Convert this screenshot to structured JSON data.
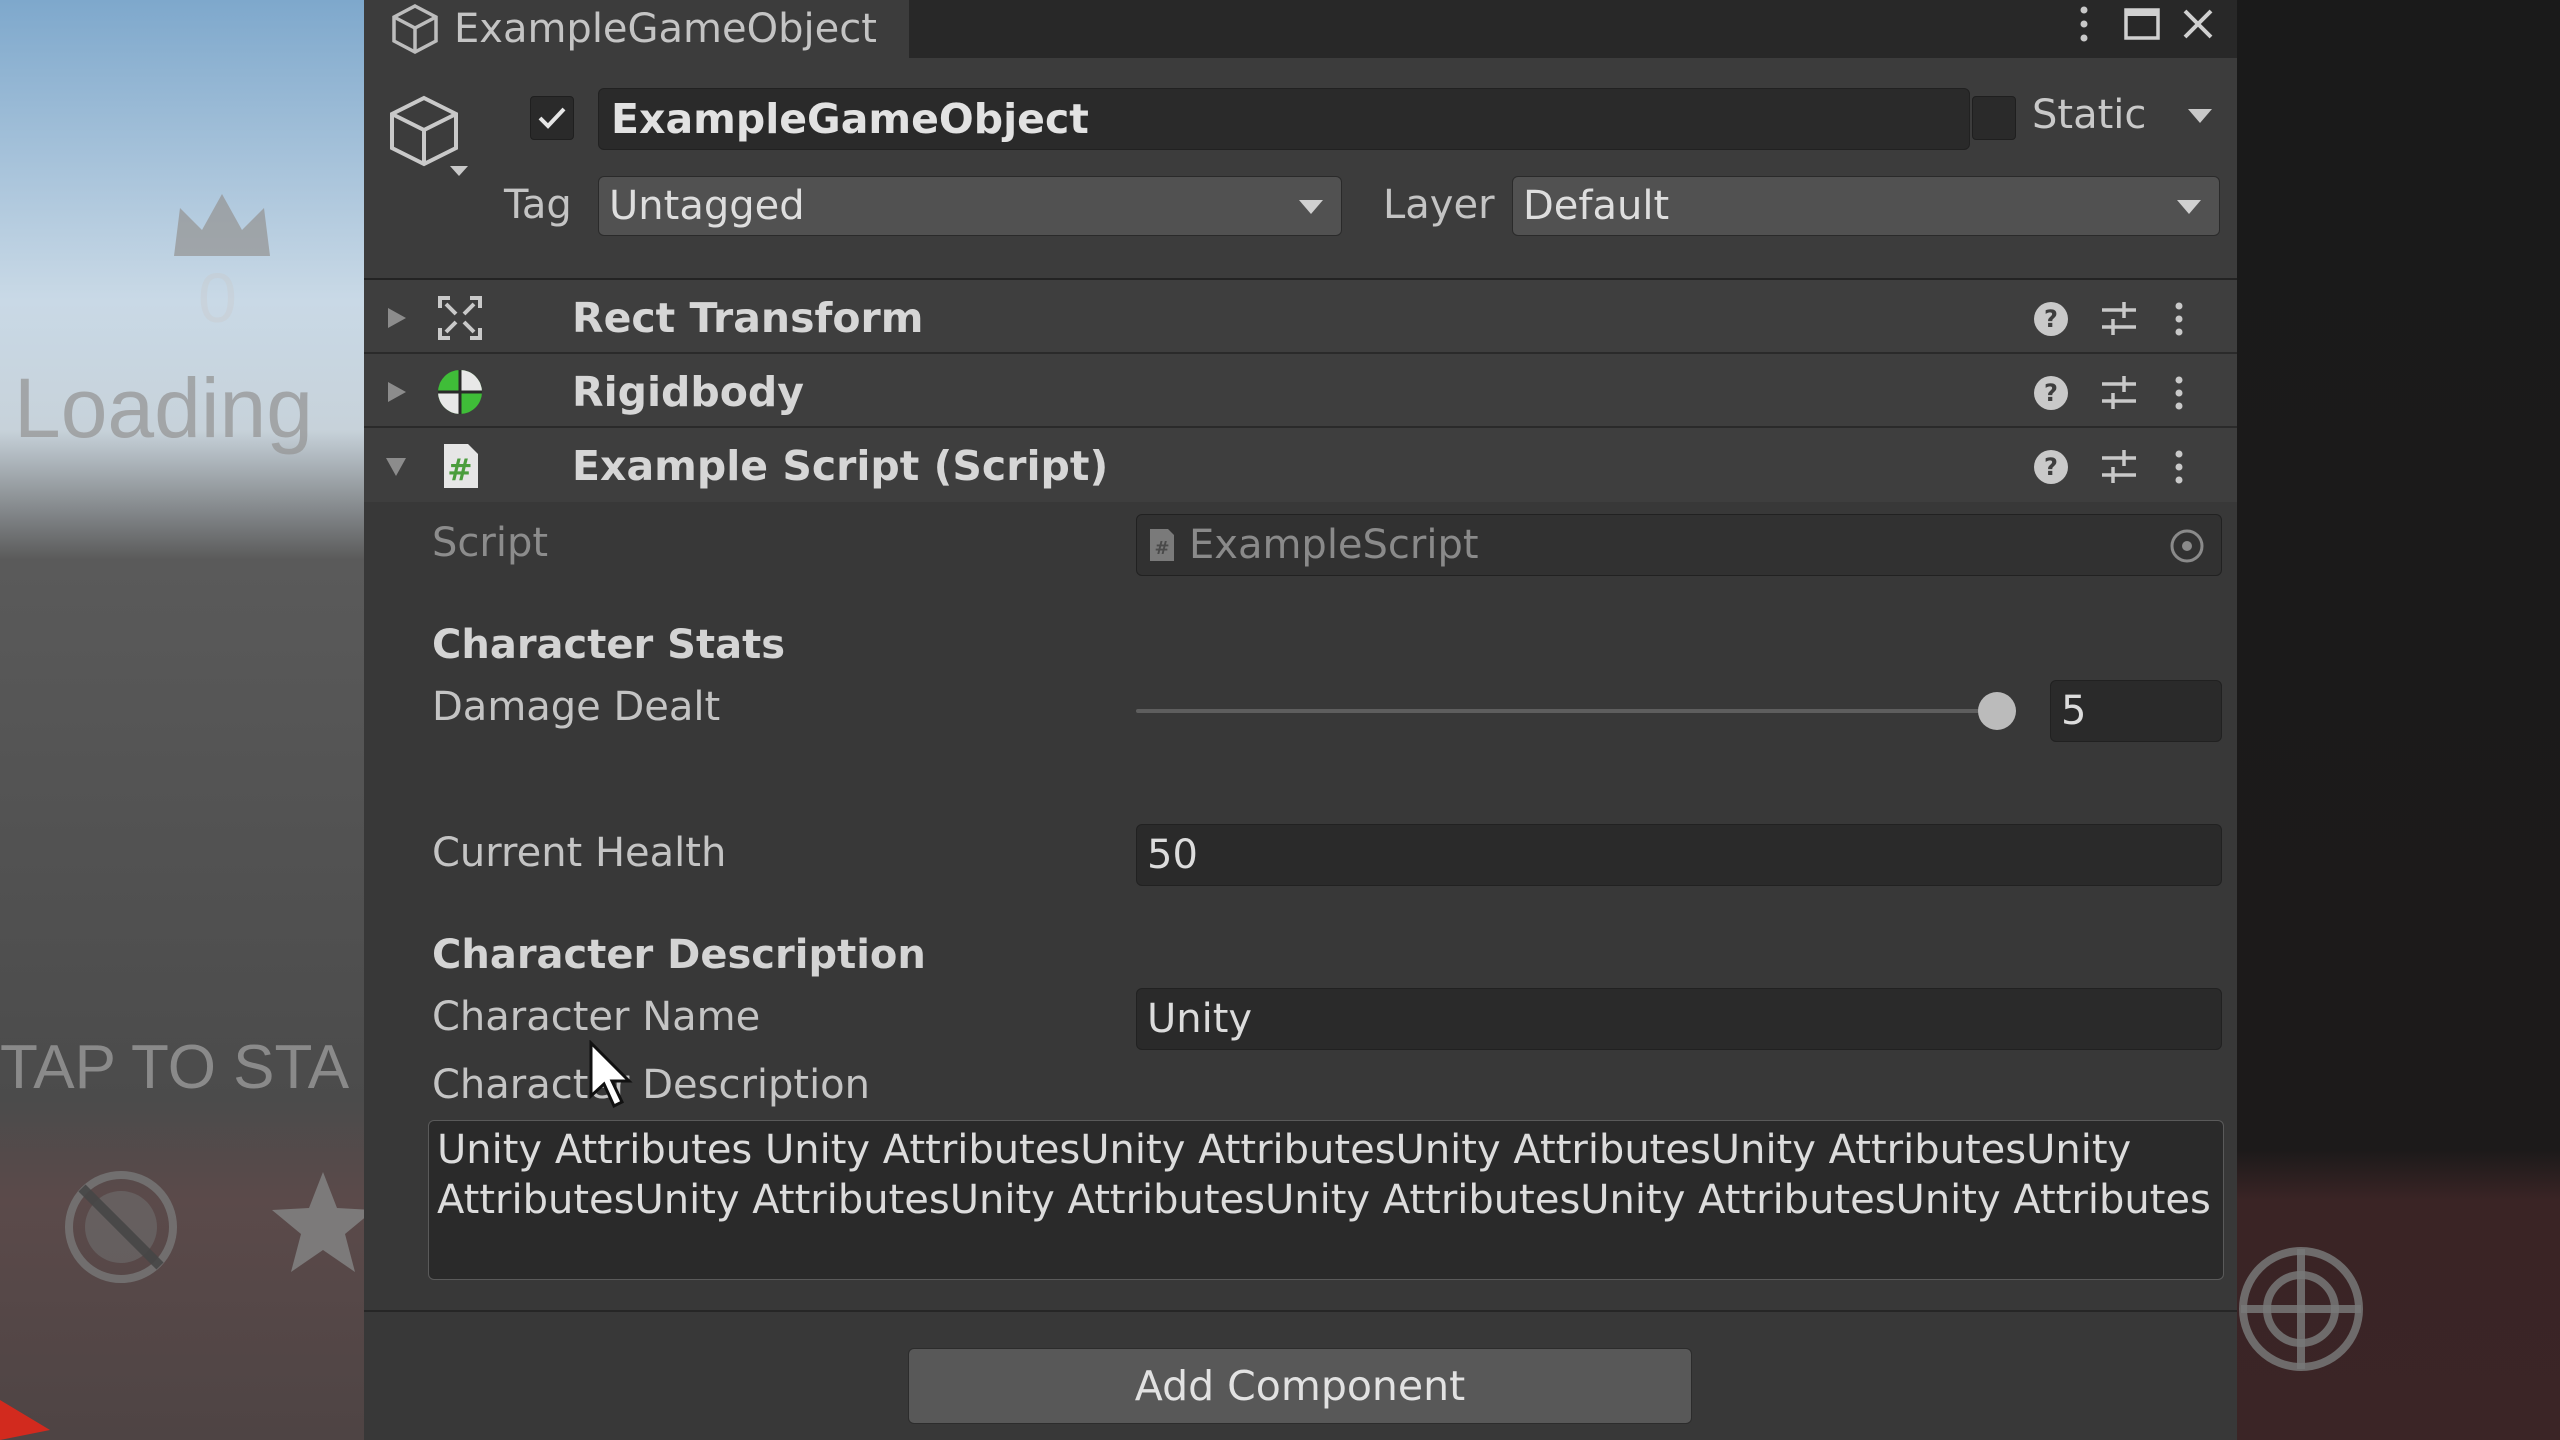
{
  "game_view": {
    "score": "0",
    "loading_text": "Loading",
    "tap_text": "TAP TO STA"
  },
  "inspector": {
    "tab_title": "ExampleGameObject",
    "object_name": "ExampleGameObject",
    "active_checked": true,
    "static_label": "Static",
    "static_checked": false,
    "tag_label": "Tag",
    "tag_value": "Untagged",
    "layer_label": "Layer",
    "layer_value": "Default",
    "components": [
      {
        "title": "Rect Transform",
        "expanded": false,
        "icon": "rect-transform-icon"
      },
      {
        "title": "Rigidbody",
        "expanded": false,
        "icon": "rigidbody-icon"
      },
      {
        "title": "Example Script (Script)",
        "expanded": true,
        "icon": "script-icon"
      }
    ],
    "script": {
      "script_label": "Script",
      "script_value": "ExampleScript",
      "stats_header": "Character Stats",
      "damage_label": "Damage Dealt",
      "damage_value": "5",
      "damage_slider_fraction": 1.0,
      "health_label": "Current Health",
      "health_value": "50",
      "description_header": "Character Description",
      "name_label": "Character Name",
      "name_value": "Unity",
      "desc_label": "Character Description",
      "desc_line1": "Unity Attributes Unity AttributesUnity AttributesUnity AttributesUnity AttributesUnity",
      "desc_line2": "AttributesUnity AttributesUnity AttributesUnity AttributesUnity AttributesUnity Attributes"
    },
    "add_component_label": "Add Component"
  },
  "colors": {
    "inspector_bg": "#383838",
    "field_bg": "#2a2a2a",
    "rigidbody_green": "#3fbd38",
    "script_green": "#4a9d3c"
  }
}
